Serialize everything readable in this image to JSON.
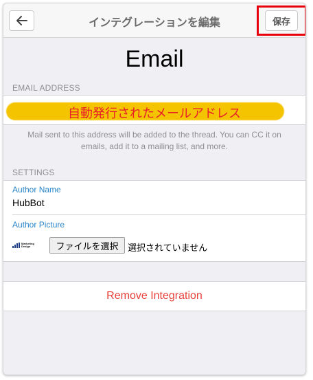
{
  "header": {
    "title": "インテグレーションを編集",
    "back_icon": "arrow-left-icon",
    "save_label": "保存",
    "highlight_color": "#e8000b"
  },
  "page": {
    "title": "Email"
  },
  "email_section": {
    "label": "EMAIL ADDRESS",
    "value": "自動発行されたメールアドレス",
    "value_color": "#e8202a",
    "highlight_color": "#f5c400",
    "help": "Mail sent to this address will be added to the thread. You can CC it on emails, add it to a mailing list, and more."
  },
  "settings": {
    "label": "SETTINGS",
    "author_name_label": "Author Name",
    "author_name_value": "HubBot",
    "author_picture_label": "Author Picture",
    "logo_text_line1": "Marketing",
    "logo_text_line2": "Design",
    "file_button_label": "ファイルを選択",
    "file_status": "選択されていません"
  },
  "remove": {
    "label": "Remove Integration",
    "color": "#e8403a"
  }
}
